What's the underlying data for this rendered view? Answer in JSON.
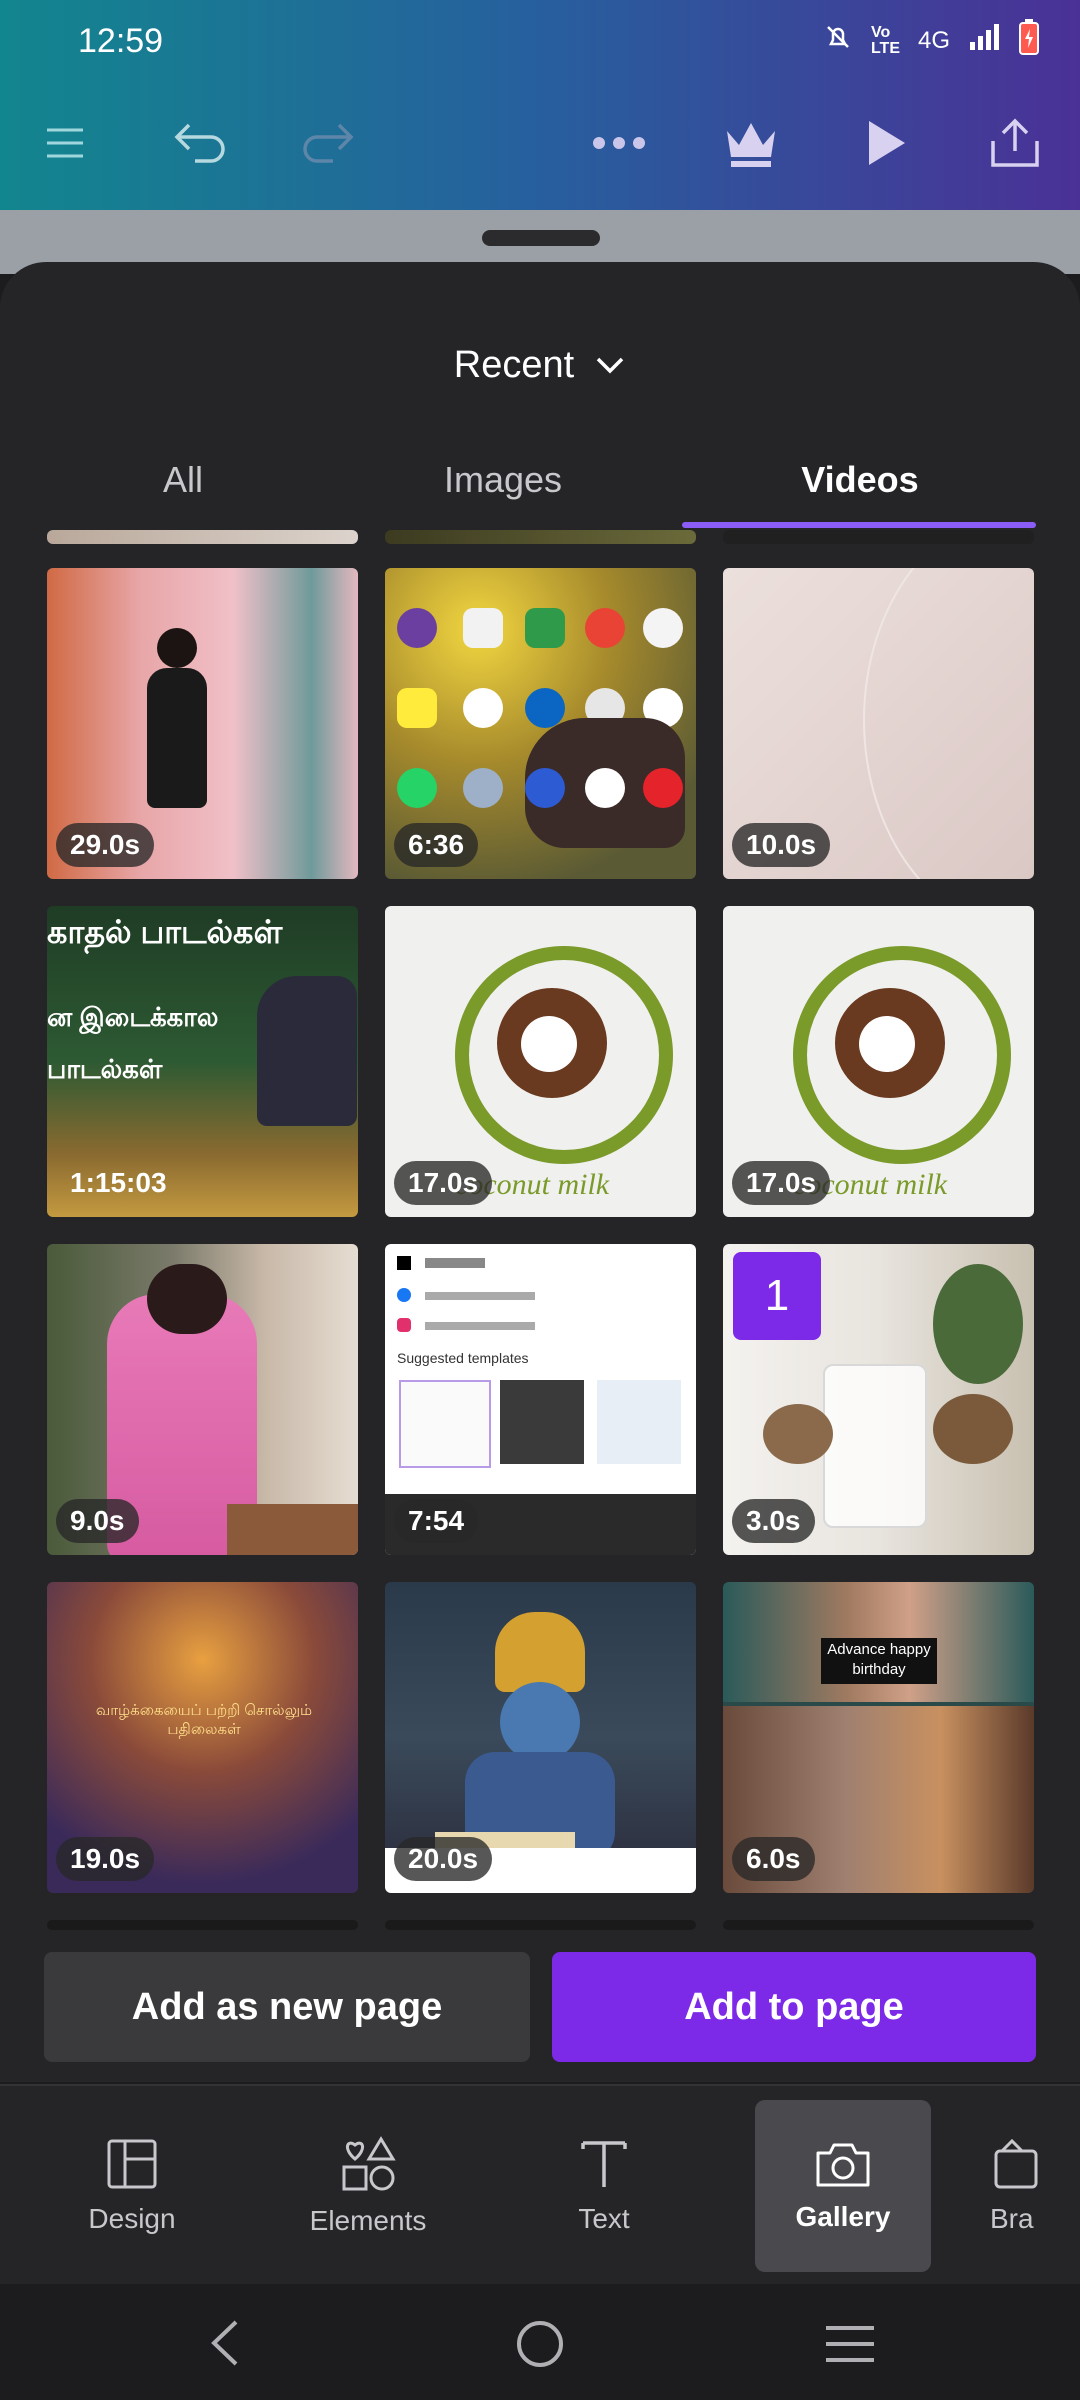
{
  "status_bar": {
    "time": "12:59",
    "network": "4G"
  },
  "toolbar": {
    "icons": [
      "menu-icon",
      "undo-icon",
      "redo-icon",
      "more-icon",
      "crown-icon",
      "play-icon",
      "share-icon"
    ]
  },
  "panel": {
    "filter_label": "Recent",
    "tabs": [
      {
        "label": "All",
        "active": false
      },
      {
        "label": "Images",
        "active": false
      },
      {
        "label": "Videos",
        "active": true
      }
    ]
  },
  "media": [
    {
      "duration": "29.0s"
    },
    {
      "duration": "6:36"
    },
    {
      "duration": "10.0s"
    },
    {
      "duration": "1:15:03"
    },
    {
      "duration": "17.0s"
    },
    {
      "duration": "17.0s"
    },
    {
      "duration": "9.0s"
    },
    {
      "duration": "7:54"
    },
    {
      "duration": "3.0s",
      "selected_index": "1"
    },
    {
      "duration": "19.0s"
    },
    {
      "duration": "20.0s"
    },
    {
      "duration": "6.0s"
    }
  ],
  "thumb_text": {
    "coconut": "coconut milk",
    "tamil_top": "காதல் பாடல்கள்",
    "tamil_mid": "ன இடைக்கால",
    "tamil_low": "பாடல்கள்",
    "birthday": "Advance happy birthday",
    "suggested": "Suggested templates",
    "vishnu": "வாழ்க்கையைப் பற்றி சொல்லும் பதிலைகள்"
  },
  "actions": {
    "add_new_page": "Add as new page",
    "add_to_page": "Add to page"
  },
  "bottom_nav": [
    {
      "label": "Design",
      "icon": "layout-icon"
    },
    {
      "label": "Elements",
      "icon": "shapes-icon"
    },
    {
      "label": "Text",
      "icon": "text-icon"
    },
    {
      "label": "Gallery",
      "icon": "camera-icon",
      "active": true
    },
    {
      "label": "Bra",
      "icon": "brand-icon"
    }
  ],
  "colors": {
    "accent": "#7d2ae8",
    "tab_indicator": "#8b5cf6",
    "sheet_bg": "#252528"
  }
}
